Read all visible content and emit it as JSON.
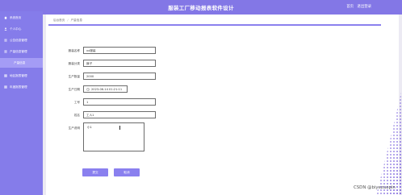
{
  "header": {
    "title": "服装工厂移动报表软件设计",
    "links": [
      "首页",
      "退出登录"
    ]
  },
  "sidebar": {
    "items": [
      {
        "label": "系统首页"
      },
      {
        "label": "个人中心"
      },
      {
        "label": "公告信息管理"
      },
      {
        "label": "产量信息管理"
      },
      {
        "label": "产量信息"
      },
      {
        "label": "地区报表管理"
      },
      {
        "label": "年度报表管理"
      }
    ]
  },
  "breadcrumb": [
    "后台首页",
    "产量信息"
  ],
  "form": {
    "fields": [
      {
        "label": "服装名称",
        "value": "xx服装"
      },
      {
        "label": "服装分类",
        "value": "裤子"
      },
      {
        "label": "生产数量",
        "value": "2000"
      },
      {
        "label": "生产日期",
        "value": "2023-06-14 01:21:11"
      },
      {
        "label": "工号",
        "value": "1"
      },
      {
        "label": "姓名",
        "value": "工人1"
      }
    ],
    "notes_label": "生产说明",
    "notes_value": "小1",
    "submit_label": "提交",
    "cancel_label": "取消"
  },
  "watermark": "CSDN @biyezuopin",
  "colors": {
    "primary": "#8377e6",
    "sidebar": "#857cea",
    "active_item": "#a49cf5",
    "button": "#8a80ef"
  }
}
